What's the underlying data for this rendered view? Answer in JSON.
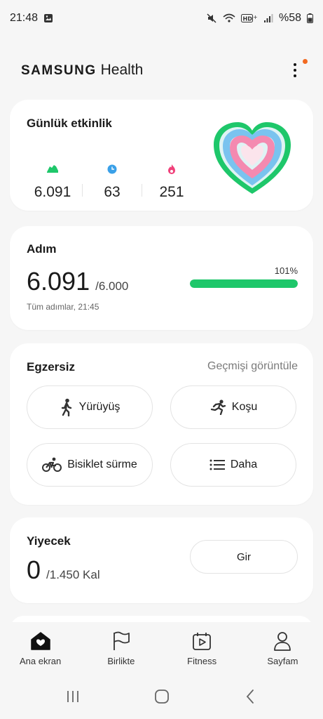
{
  "status_bar": {
    "time": "21:48",
    "battery": "%58"
  },
  "header": {
    "brand_samsung": "SAMSUNG",
    "brand_health": "Health"
  },
  "activity": {
    "title": "Günlük etkinlik",
    "steps": "6.091",
    "minutes": "63",
    "calories": "251",
    "colors": {
      "steps": "#1ec76a",
      "minutes": "#3aa0e8",
      "calories": "#f0407a"
    }
  },
  "steps_card": {
    "title": "Adım",
    "value": "6.091",
    "goal": "/6.000",
    "percent": "101%",
    "progress_fraction": 1.0,
    "note": "Tüm adımlar, 21:45"
  },
  "exercise": {
    "title": "Egzersiz",
    "history": "Geçmişi görüntüle",
    "buttons": {
      "walk": "Yürüyüş",
      "run": "Koşu",
      "bike": "Bisiklet sürme",
      "more": "Daha"
    }
  },
  "food": {
    "title": "Yiyecek",
    "value": "0",
    "goal": "/1.450 Kal",
    "enter": "Gir"
  },
  "bottom_nav": {
    "home": "Ana ekran",
    "together": "Birlikte",
    "fitness": "Fitness",
    "mypage": "Sayfam"
  },
  "icons": {
    "walk": "walking-person-icon",
    "run": "running-person-icon",
    "bike": "cyclist-icon",
    "more": "list-icon"
  }
}
